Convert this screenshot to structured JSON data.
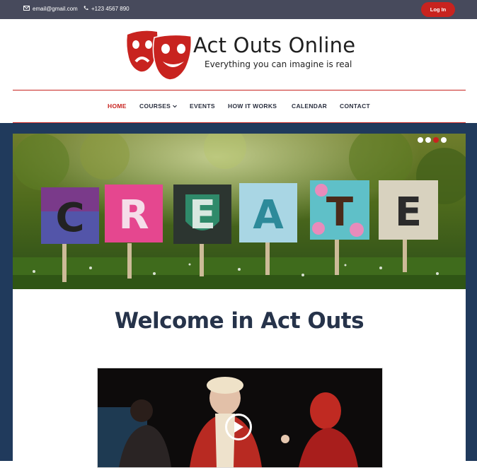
{
  "topbar": {
    "email": "email@gmail.com",
    "phone": "+123 4567 890",
    "login_label": "Log In",
    "email_icon": "envelope-icon",
    "phone_icon": "phone-icon"
  },
  "brand": {
    "name": "Act Outs Online",
    "tagline": "Everything you can imagine is real",
    "logo_icon": "theater-masks-icon"
  },
  "nav": {
    "items": [
      {
        "label": "HOME",
        "active": true
      },
      {
        "label": "COURSES",
        "has_dropdown": true
      },
      {
        "label": "EVENTS"
      },
      {
        "label": "HOW IT WORKS"
      },
      {
        "label": "CALENDAR"
      },
      {
        "label": "CONTACT"
      }
    ],
    "dropdown_icon": "chevron-down-icon"
  },
  "slider": {
    "signs": [
      "C",
      "R",
      "E",
      "A",
      "T",
      "E"
    ],
    "slide_count": 4,
    "active_slide": 3
  },
  "main": {
    "heading": "Welcome in Act Outs",
    "video_icon": "play-icon"
  },
  "colors": {
    "accent": "#c8231f",
    "topbar": "#474a5c",
    "navy": "#203a5c",
    "heading": "#26334a"
  }
}
